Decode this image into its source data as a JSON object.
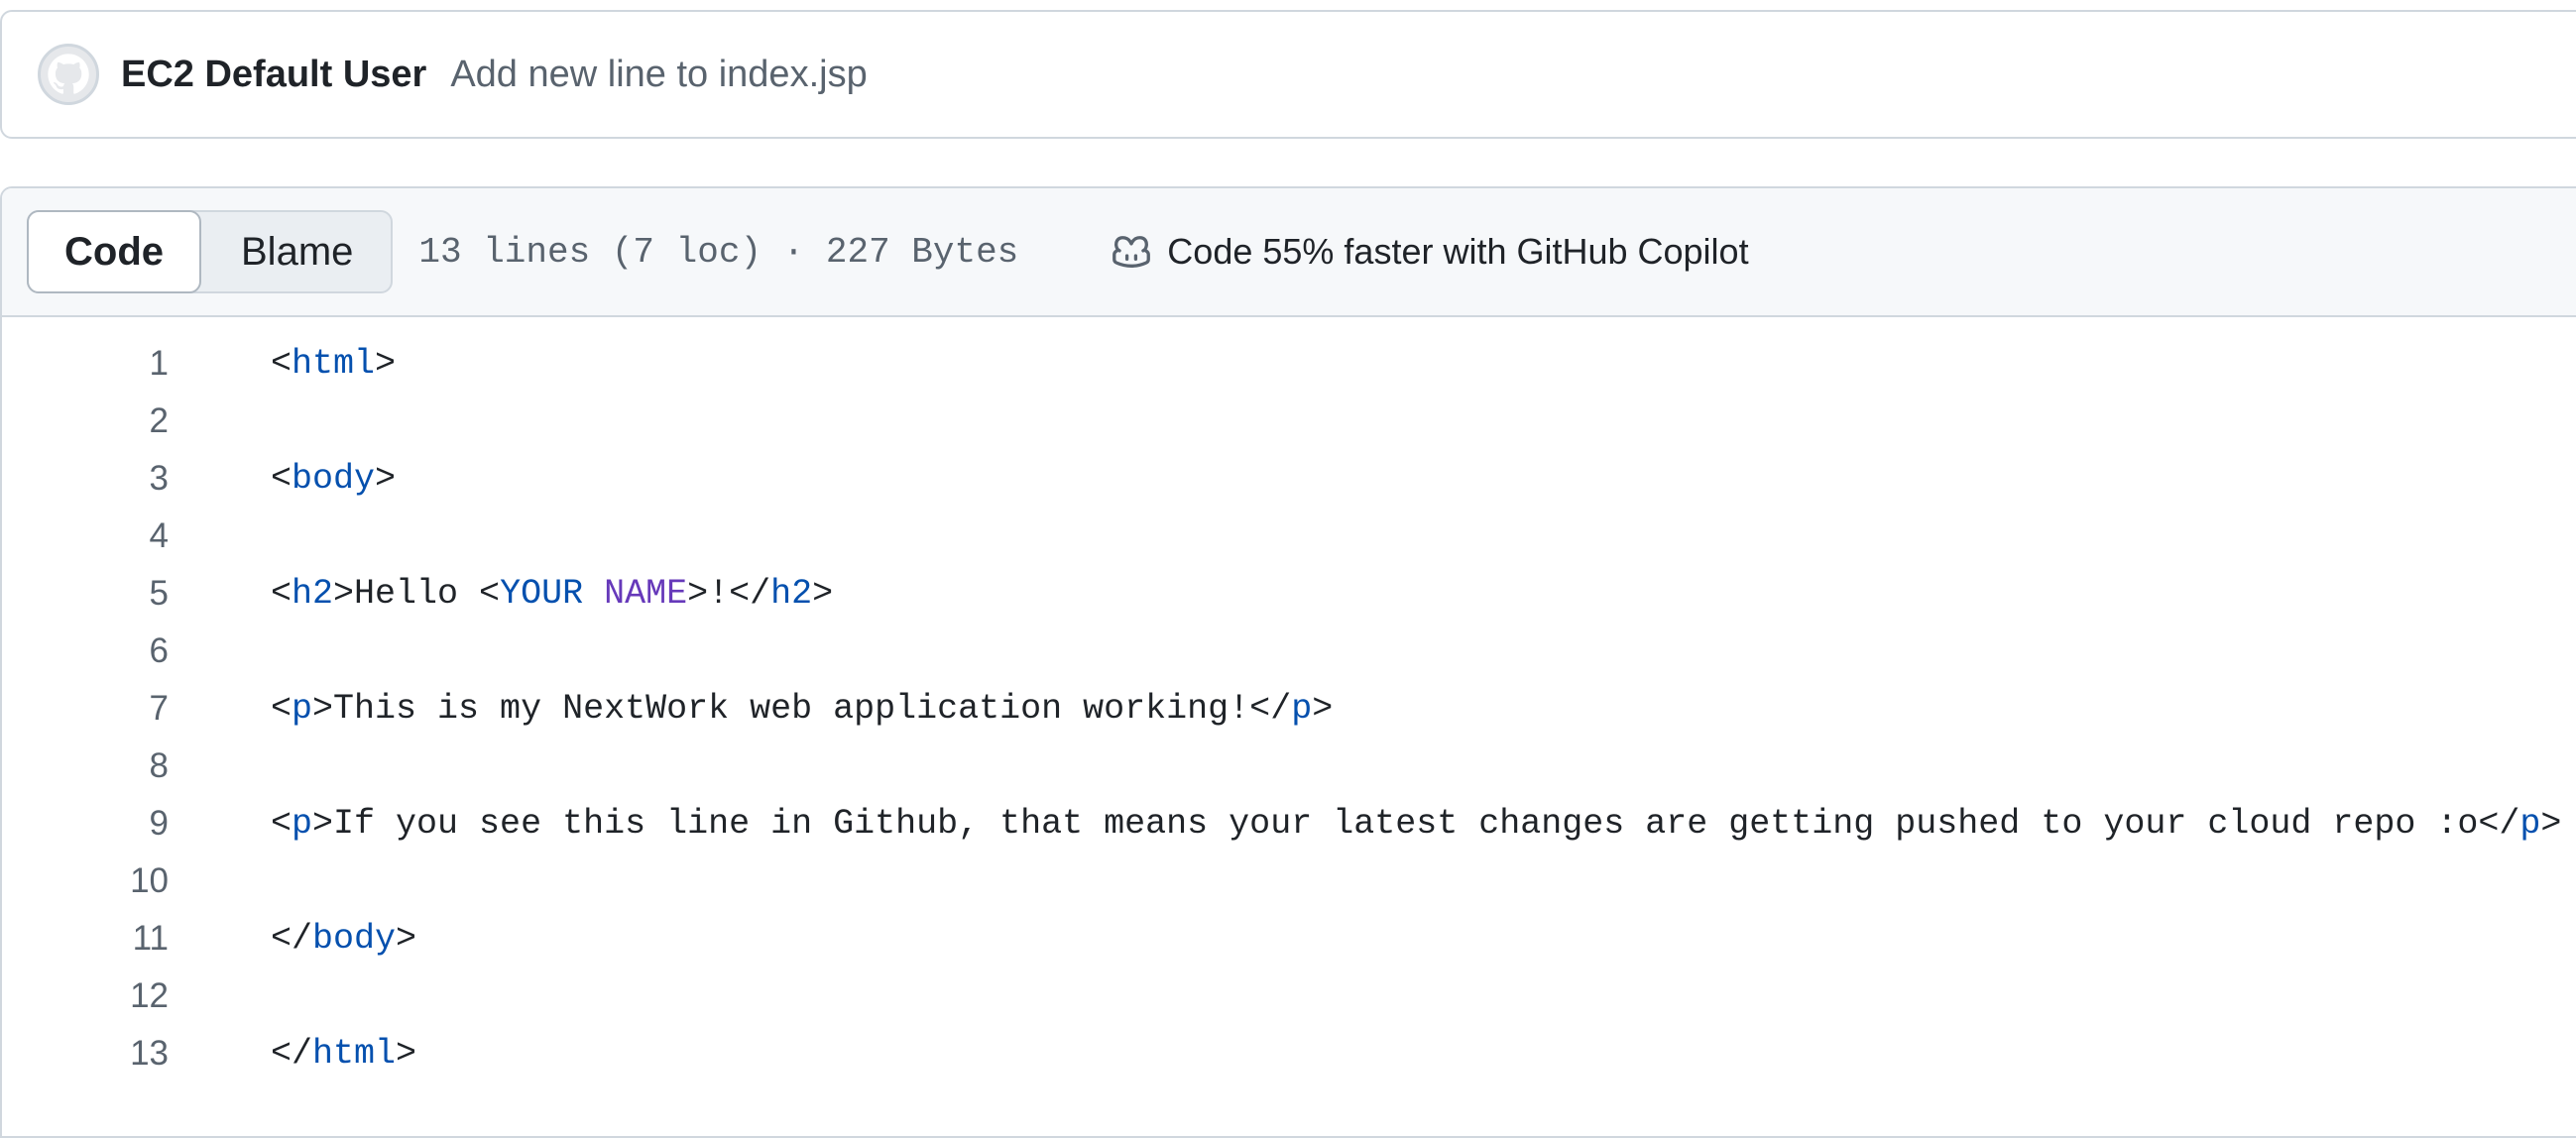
{
  "commit": {
    "author": "EC2 Default User",
    "message": "Add new line to index.jsp",
    "avatar_icon": "github-avatar-icon"
  },
  "file_header": {
    "tabs": [
      {
        "label": "Code",
        "active": true
      },
      {
        "label": "Blame",
        "active": false
      }
    ],
    "meta": "13 lines (7 loc) · 227 Bytes",
    "copilot_icon": "copilot-icon",
    "copilot_text": "Code 55% faster with GitHub Copilot"
  },
  "code": {
    "lines": [
      {
        "num": "1",
        "tokens": [
          {
            "t": "<",
            "c": ""
          },
          {
            "t": "html",
            "c": "tag"
          },
          {
            "t": ">",
            "c": ""
          }
        ]
      },
      {
        "num": "2",
        "tokens": []
      },
      {
        "num": "3",
        "tokens": [
          {
            "t": "<",
            "c": ""
          },
          {
            "t": "body",
            "c": "tag"
          },
          {
            "t": ">",
            "c": ""
          }
        ]
      },
      {
        "num": "4",
        "tokens": []
      },
      {
        "num": "5",
        "tokens": [
          {
            "t": "<",
            "c": ""
          },
          {
            "t": "h2",
            "c": "tag"
          },
          {
            "t": ">Hello <",
            "c": ""
          },
          {
            "t": "YOUR",
            "c": "tag"
          },
          {
            "t": " ",
            "c": ""
          },
          {
            "t": "NAME",
            "c": "ent"
          },
          {
            "t": ">!</",
            "c": ""
          },
          {
            "t": "h2",
            "c": "tag"
          },
          {
            "t": ">",
            "c": ""
          }
        ]
      },
      {
        "num": "6",
        "tokens": []
      },
      {
        "num": "7",
        "tokens": [
          {
            "t": "<",
            "c": ""
          },
          {
            "t": "p",
            "c": "tag"
          },
          {
            "t": ">This is my NextWork web application working!</",
            "c": ""
          },
          {
            "t": "p",
            "c": "tag"
          },
          {
            "t": ">",
            "c": ""
          }
        ]
      },
      {
        "num": "8",
        "tokens": []
      },
      {
        "num": "9",
        "tokens": [
          {
            "t": "<",
            "c": ""
          },
          {
            "t": "p",
            "c": "tag"
          },
          {
            "t": ">If you see this line in Github, that means your latest changes are getting pushed to your cloud repo :o</",
            "c": ""
          },
          {
            "t": "p",
            "c": "tag"
          },
          {
            "t": ">",
            "c": ""
          }
        ]
      },
      {
        "num": "10",
        "tokens": []
      },
      {
        "num": "11",
        "tokens": [
          {
            "t": "</",
            "c": ""
          },
          {
            "t": "body",
            "c": "tag"
          },
          {
            "t": ">",
            "c": ""
          }
        ]
      },
      {
        "num": "12",
        "tokens": []
      },
      {
        "num": "13",
        "tokens": [
          {
            "t": "</",
            "c": ""
          },
          {
            "t": "html",
            "c": "tag"
          },
          {
            "t": ">",
            "c": ""
          }
        ]
      }
    ]
  },
  "colors": {
    "tag": "#0550ae",
    "entity": "#6639ba",
    "text": "#1f2328",
    "muted": "#59636e",
    "border": "#d0d7de",
    "header_bg": "#f6f8fa"
  }
}
